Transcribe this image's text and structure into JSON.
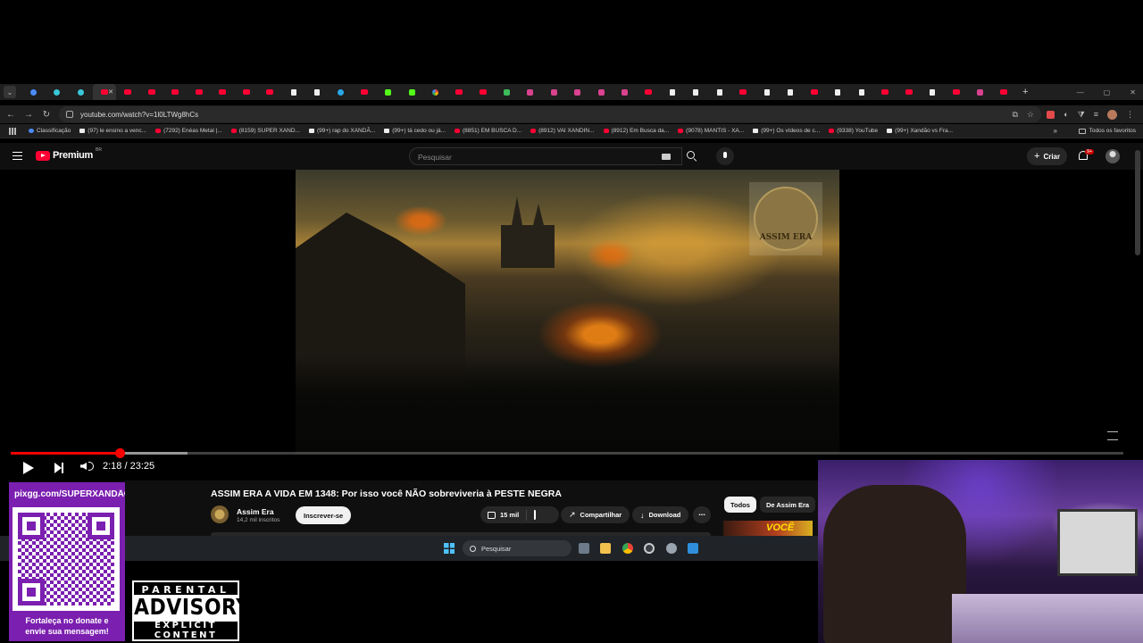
{
  "browser": {
    "tabs": [
      {
        "icon": "bl",
        "label": "Tab"
      },
      {
        "icon": "cy",
        "label": "Tab"
      },
      {
        "icon": "cy",
        "label": "Tab"
      },
      {
        "icon": "yt",
        "label": "Tab",
        "active": true
      },
      {
        "icon": "yt",
        "label": "Tab"
      },
      {
        "icon": "yt",
        "label": "Tab"
      },
      {
        "icon": "yt",
        "label": "Tab"
      },
      {
        "icon": "yt",
        "label": "Tab"
      },
      {
        "icon": "yt",
        "label": "Tab"
      },
      {
        "icon": "yt",
        "label": "Tab"
      },
      {
        "icon": "yt",
        "label": "Tab"
      },
      {
        "icon": "tt",
        "label": "Tab"
      },
      {
        "icon": "tt",
        "label": "Tab"
      },
      {
        "icon": "tg",
        "label": "Tab"
      },
      {
        "icon": "yt",
        "label": "Tab"
      },
      {
        "icon": "kk",
        "label": "Tab"
      },
      {
        "icon": "kk",
        "label": "Tab"
      },
      {
        "icon": "gg",
        "label": "Tab"
      },
      {
        "icon": "yt",
        "label": "Tab"
      },
      {
        "icon": "yt",
        "label": "Tab"
      },
      {
        "icon": "vv",
        "label": "Tab"
      },
      {
        "icon": "ig",
        "label": "Tab"
      },
      {
        "icon": "ig",
        "label": "Tab"
      },
      {
        "icon": "ig",
        "label": "Tab"
      },
      {
        "icon": "ig",
        "label": "Tab"
      },
      {
        "icon": "ig",
        "label": "Tab"
      },
      {
        "icon": "yt",
        "label": "Tab"
      },
      {
        "icon": "tt",
        "label": "Tab"
      },
      {
        "icon": "tt",
        "label": "Tab"
      },
      {
        "icon": "tt",
        "label": "Tab"
      },
      {
        "icon": "yt",
        "label": "Tab"
      },
      {
        "icon": "tt",
        "label": "Tab"
      },
      {
        "icon": "tt",
        "label": "Tab"
      },
      {
        "icon": "yt",
        "label": "Tab"
      },
      {
        "icon": "tt",
        "label": "Tab"
      },
      {
        "icon": "tt",
        "label": "Tab"
      },
      {
        "icon": "yt",
        "label": "Tab"
      },
      {
        "icon": "yt",
        "label": "Tab"
      },
      {
        "icon": "tt",
        "label": "Tab"
      },
      {
        "icon": "yt",
        "label": "Tab"
      },
      {
        "icon": "ig",
        "label": "Tab"
      },
      {
        "icon": "yt",
        "label": "Tab"
      }
    ],
    "new_tab": "+",
    "url": "youtube.com/watch?v=1l0LTWg8hCs",
    "bookmarks": [
      {
        "icon": "bl",
        "label": "Classificação"
      },
      {
        "icon": "tt",
        "label": "(97) le ensino a venc..."
      },
      {
        "icon": "yt",
        "label": "(7292) Enéas Metal |..."
      },
      {
        "icon": "yt",
        "label": "(8159) SUPER XAND..."
      },
      {
        "icon": "tt",
        "label": "(99+) rap do XANDÃ..."
      },
      {
        "icon": "tt",
        "label": "(99+) tá cedo ou já..."
      },
      {
        "icon": "yt",
        "label": "(8851) EM BUSCA D..."
      },
      {
        "icon": "yt",
        "label": "(8912) VAI XANDIN..."
      },
      {
        "icon": "yt",
        "label": "(8912) Em Busca da..."
      },
      {
        "icon": "yt",
        "label": "(9078) MANTIS - XA..."
      },
      {
        "icon": "tt",
        "label": "(99+) Os vídeos de c..."
      },
      {
        "icon": "yt",
        "label": "(9338) YouTube"
      },
      {
        "icon": "tt",
        "label": "(99+) Xandão vs Fra..."
      }
    ],
    "bookmarks_more": "»",
    "all_bookmarks": "Todos os favoritos"
  },
  "youtube": {
    "logo_text": "Premium",
    "region": "BR",
    "search_placeholder": "Pesquisar",
    "create_label": "Criar",
    "notifications_badge": "9+"
  },
  "player": {
    "current_time": "2:18",
    "duration": "23:25",
    "progress": 0.0982,
    "buffered": 0.159,
    "watermark_text": "ASSIM ERA"
  },
  "video": {
    "title": "ASSIM ERA A VIDA EM 1348: Por isso você NÃO sobreviveria à PESTE NEGRA",
    "channel": "Assim Era",
    "subscribers": "14,2 mil inscritos",
    "subscribe_label": "Inscrever-se",
    "likes": "15 mil",
    "share_label": "Compartilhar",
    "download_label": "Download",
    "more_label": "⋯",
    "chips": [
      "Todos",
      "De Assim Era"
    ],
    "suggested_thumb_text": "VOCÊ"
  },
  "taskbar": {
    "search_placeholder": "Pesquisar"
  },
  "overlay": {
    "donate_url": "pixgg.com/SUPERXANDÃO",
    "donate_message_1": "Fortaleça no donate e",
    "donate_message_2": "envie sua mensagem!",
    "advisory_top": "PARENTAL",
    "advisory_mid": "ADVISORY",
    "advisory_bottom": "EXPLICIT CONTENT"
  },
  "colors": {
    "youtube_red": "#ff0033",
    "overlay_purple": "#7b1fb0",
    "windows_blue": "#4cc2ff"
  }
}
